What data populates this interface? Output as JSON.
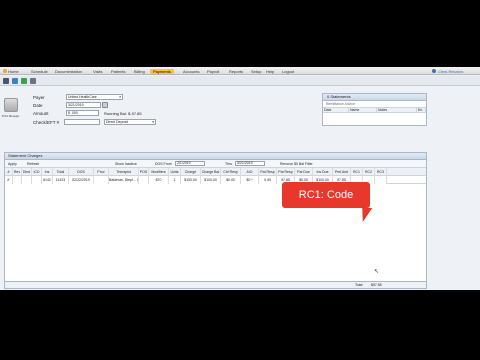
{
  "nav": {
    "items": [
      "Home",
      "Schedule",
      "Documentation",
      "Visits",
      "Patients",
      "Billing",
      "Payments",
      "Accounts",
      "Payroll",
      "Reports",
      "Setup",
      "Help",
      "Logout"
    ],
    "active": "Payments",
    "user": "Chris Recaros"
  },
  "form": {
    "icon_label": "Print Receipt",
    "payer_label": "Payer",
    "payer_value": "United HealthCare",
    "date_label": "Date",
    "date_value": "3/21/2019",
    "amount_label": "Amount",
    "amount_value": "$ .000",
    "running_bal": "Running Bal: $-97.85",
    "check_label": "Check/EFT #",
    "check_value": "",
    "deposit_value": "Direct Deposit"
  },
  "statements": {
    "title": "0 Statements",
    "subtitle": "Remittance Advice",
    "columns": [
      "Date",
      "Name",
      "Notes",
      "En"
    ]
  },
  "charges": {
    "title": "Statement Charges",
    "tools": [
      "Apply",
      "Refresh",
      "Show Inactive",
      "DOS From",
      "2/1/2019",
      "Thru",
      "3/21/2019",
      "Remove $0 Bal Filter"
    ],
    "columns": [
      "#",
      "Rev",
      "Dlnd",
      "ICD",
      "Ins",
      "Total",
      "DOS",
      "Prov",
      "Therapist",
      "POS",
      "Modifiers",
      "Units",
      "Charge",
      "Charge Bal",
      "Ctrl Resp",
      "A/O",
      "Pat Resp",
      "Pat Resp",
      "Pat Due",
      "Ins Due",
      "Pmt Amt",
      "RC1",
      "RC2",
      "RC3"
    ],
    "row": [
      "",
      "",
      "",
      "",
      "6142",
      "11923",
      "02/22/2019",
      "",
      "Balderas, Stepf... 11",
      "",
      "$70",
      "1",
      "$100.00",
      "$100.00",
      "$0.00",
      "$0 *",
      "0.99",
      "97.85",
      "$0.00",
      "$100.00",
      "97.85",
      "",
      "",
      ""
    ],
    "total_label": "Total",
    "total_value": "$97.85"
  },
  "callout": "RC1: Code"
}
